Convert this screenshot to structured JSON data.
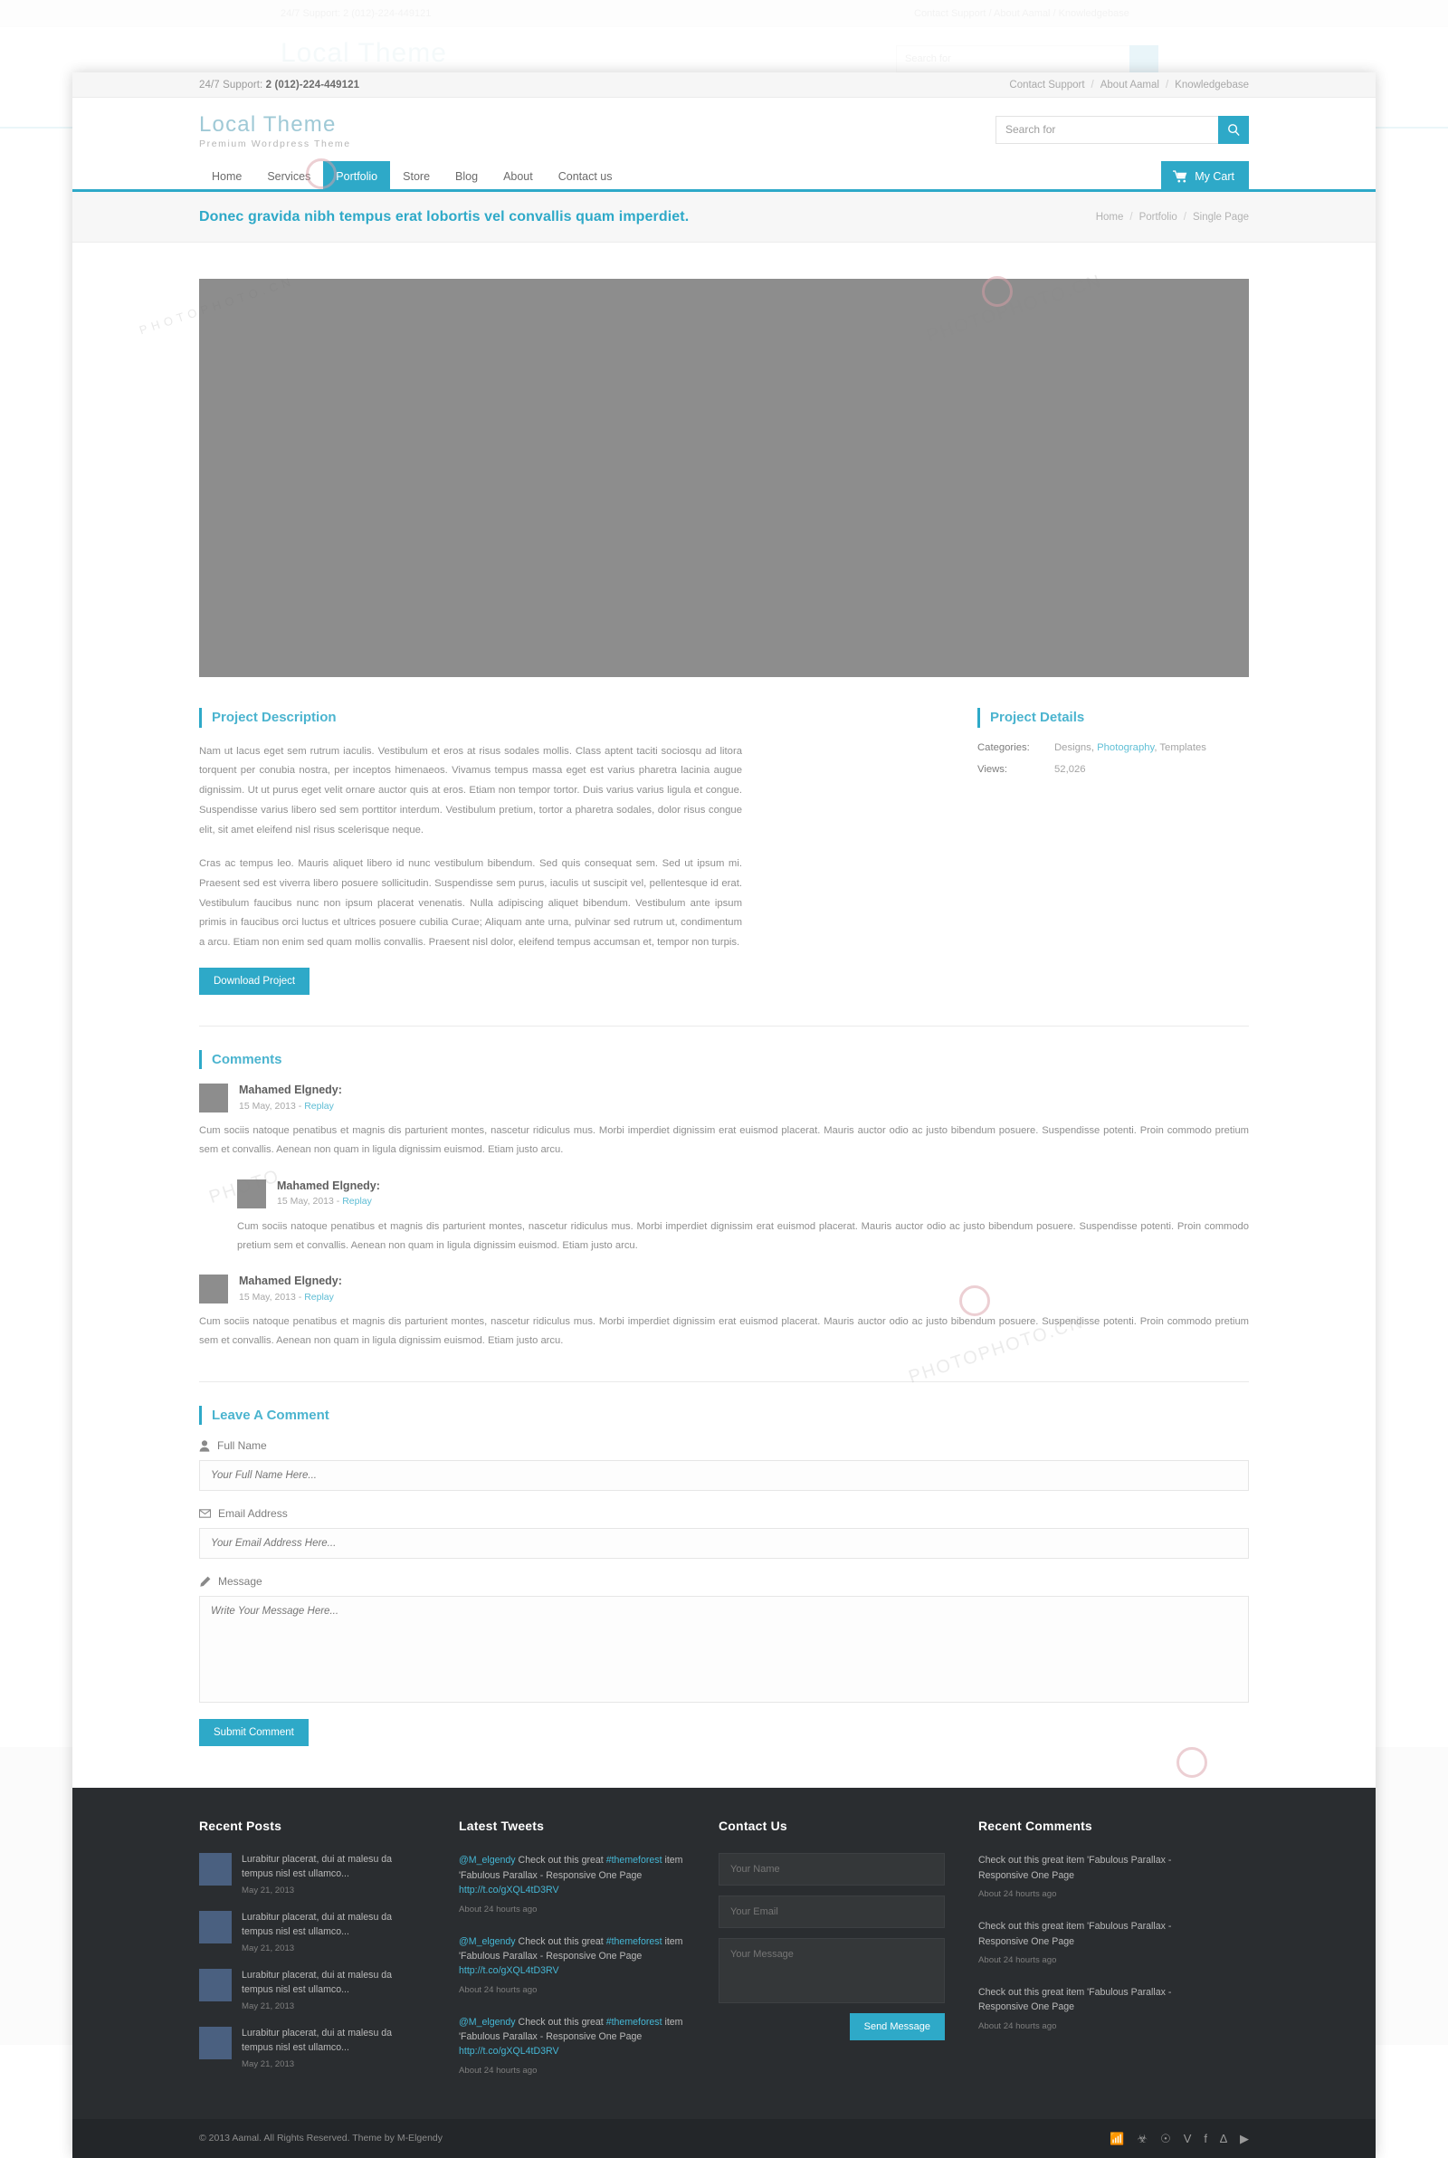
{
  "topbar": {
    "support_label": "24/7 Support:",
    "support_phone": "2 (012)-224-449121",
    "links": [
      "Contact Support",
      "About Aamal",
      "Knowledgebase"
    ]
  },
  "header": {
    "brand_title": "Local Theme",
    "brand_sub": "Premium Wordpress Theme",
    "search_placeholder": "Search for",
    "search_value": "",
    "search_icon": "search-icon"
  },
  "nav": {
    "items": [
      {
        "label": "Home",
        "active": false
      },
      {
        "label": "Services",
        "active": false
      },
      {
        "label": "Portfolio",
        "active": true
      },
      {
        "label": "Store",
        "active": false
      },
      {
        "label": "Blog",
        "active": false
      },
      {
        "label": "About",
        "active": false
      },
      {
        "label": "Contact us",
        "active": false
      }
    ],
    "cart_label": "My Cart",
    "cart_icon": "shopping-cart-icon"
  },
  "titlebar": {
    "title": "Donec gravida nibh tempus erat lobortis vel convallis quam imperdiet.",
    "breadcrumb": [
      "Home",
      "Portfolio",
      "Single Page"
    ]
  },
  "project": {
    "description_heading": "Project Description",
    "paragraph1": "Nam ut lacus eget sem rutrum iaculis. Vestibulum et eros at risus sodales mollis. Class aptent taciti sociosqu ad litora torquent per conubia nostra, per inceptos himenaeos. Vivamus tempus massa eget est varius pharetra lacinia augue dignissim. Ut ut purus eget velit ornare auctor quis at eros. Etiam non tempor tortor. Duis varius varius ligula et congue. Suspendisse varius libero sed sem porttitor interdum. Vestibulum pretium, tortor a pharetra sodales, dolor risus congue elit, sit amet eleifend nisl risus scelerisque neque.",
    "paragraph2": "Cras ac tempus leo. Mauris aliquet libero id nunc vestibulum bibendum. Sed quis consequat sem. Sed ut ipsum mi. Praesent sed est viverra libero posuere sollicitudin. Suspendisse sem purus, iaculis ut suscipit vel, pellentesque id erat. Vestibulum faucibus nunc non ipsum placerat venenatis. Nulla adipiscing aliquet bibendum. Vestibulum ante ipsum primis in faucibus orci luctus et ultrices posuere cubilia Curae; Aliquam ante urna, pulvinar sed rutrum ut, condimentum a arcu. Etiam non enim sed quam mollis convallis. Praesent nisl dolor, eleifend tempus accumsan et, tempor non turpis.",
    "download_label": "Download Project",
    "details_heading": "Project Details",
    "details": [
      {
        "key": "Categories:",
        "value": "Designs, Photography, Templates",
        "link_part": "Photography"
      },
      {
        "key": "Views:",
        "value": "52,026",
        "link_part": ""
      }
    ]
  },
  "comments": {
    "heading": "Comments",
    "items": [
      {
        "author": "Mahamed Elgnedy:",
        "date": "15 May, 2013 -",
        "reply_label": "Replay",
        "text": "Cum sociis natoque penatibus et magnis dis parturient montes, nascetur ridiculus mus. Morbi imperdiet dignissim erat euismod placerat. Mauris auctor odio ac justo bibendum posuere. Suspendisse potenti. Proin commodo pretium sem et convallis. Aenean non quam in ligula dignissim euismod. Etiam justo arcu.",
        "is_reply": false
      },
      {
        "author": "Mahamed Elgnedy:",
        "date": "15 May, 2013 -",
        "reply_label": "Replay",
        "text": "Cum sociis natoque penatibus et magnis dis parturient montes, nascetur ridiculus mus. Morbi imperdiet dignissim erat euismod placerat. Mauris auctor odio ac justo bibendum posuere. Suspendisse potenti. Proin commodo pretium sem et convallis. Aenean non quam in ligula dignissim euismod. Etiam justo arcu.",
        "is_reply": true
      },
      {
        "author": "Mahamed Elgnedy:",
        "date": "15 May, 2013 -",
        "reply_label": "Replay",
        "text": "Cum sociis natoque penatibus et magnis dis parturient montes, nascetur ridiculus mus. Morbi imperdiet dignissim erat euismod placerat. Mauris auctor odio ac justo bibendum posuere. Suspendisse potenti. Proin commodo pretium sem et convallis. Aenean non quam in ligula dignissim euismod. Etiam justo arcu.",
        "is_reply": false
      }
    ]
  },
  "comment_form": {
    "heading": "Leave A Comment",
    "name_label": "Full Name",
    "name_icon": "user-icon",
    "name_placeholder": "Your Full Name Here...",
    "name_value": "",
    "email_label": "Email Address",
    "email_icon": "envelope-icon",
    "email_placeholder": "Your Email Address Here...",
    "email_value": "",
    "message_label": "Message",
    "message_icon": "pencil-icon",
    "message_placeholder": "Write Your Message Here...",
    "message_value": "",
    "submit_label": "Submit Comment"
  },
  "footer": {
    "recent_posts": {
      "heading": "Recent Posts",
      "items": [
        {
          "text": "Lurabitur placerat, dui at malesu da tempus nisl est ullamco...",
          "date": "May 21, 2013"
        },
        {
          "text": "Lurabitur placerat, dui at malesu da tempus nisl est ullamco...",
          "date": "May 21, 2013"
        },
        {
          "text": "Lurabitur placerat, dui at malesu da tempus nisl est ullamco...",
          "date": "May 21, 2013"
        },
        {
          "text": "Lurabitur placerat, dui at malesu da tempus nisl est ullamco...",
          "date": "May 21, 2013"
        }
      ]
    },
    "latest_tweets": {
      "heading": "Latest Tweets",
      "items": [
        {
          "handle": "@M_elgendy",
          "text": " Check out this great ",
          "tag": "#themeforest",
          "rest": " item 'Fabulous Parallax - Responsive One Page ",
          "url": "http://t.co/gXQL4tD3RV",
          "date": "About 24 hourts ago"
        },
        {
          "handle": "@M_elgendy",
          "text": " Check out this great ",
          "tag": "#themeforest",
          "rest": " item 'Fabulous Parallax - Responsive One Page ",
          "url": "http://t.co/gXQL4tD3RV",
          "date": "About 24 hourts ago"
        },
        {
          "handle": "@M_elgendy",
          "text": " Check out this great ",
          "tag": "#themeforest",
          "rest": " item 'Fabulous Parallax - Responsive One Page ",
          "url": "http://t.co/gXQL4tD3RV",
          "date": "About 24 hourts ago"
        }
      ]
    },
    "contact": {
      "heading": "Contact Us",
      "name_placeholder": "Your Name",
      "name_value": "",
      "email_placeholder": "Your Email",
      "email_value": "",
      "message_placeholder": "Your Message",
      "message_value": "",
      "send_label": "Send Message"
    },
    "recent_comments": {
      "heading": "Recent Comments",
      "items": [
        {
          "text": "Check out this great item 'Fabulous Parallax - Responsive One Page",
          "date": "About 24 hourts ago"
        },
        {
          "text": "Check out this great item 'Fabulous Parallax - Responsive One Page",
          "date": "About 24 hourts ago"
        },
        {
          "text": "Check out this great item 'Fabulous Parallax - Responsive One Page",
          "date": "About 24 hourts ago"
        }
      ]
    },
    "copyright": "© 2013 Aamal. All Rights Reserved. Theme by M-Elgendy",
    "socials": [
      "rss-icon",
      "twitter-icon",
      "dribbble-icon",
      "vimeo-icon",
      "facebook-icon",
      "behance-icon",
      "youtube-icon"
    ]
  },
  "theme": {
    "accent": "#2ea9c8",
    "accent_light": "#4bb4cf",
    "footer_bg": "#2a2d30",
    "copybar_bg": "#232629"
  },
  "watermark": {
    "brand": "PHOTOPHOTO.CN",
    "site": "PHOTO"
  }
}
